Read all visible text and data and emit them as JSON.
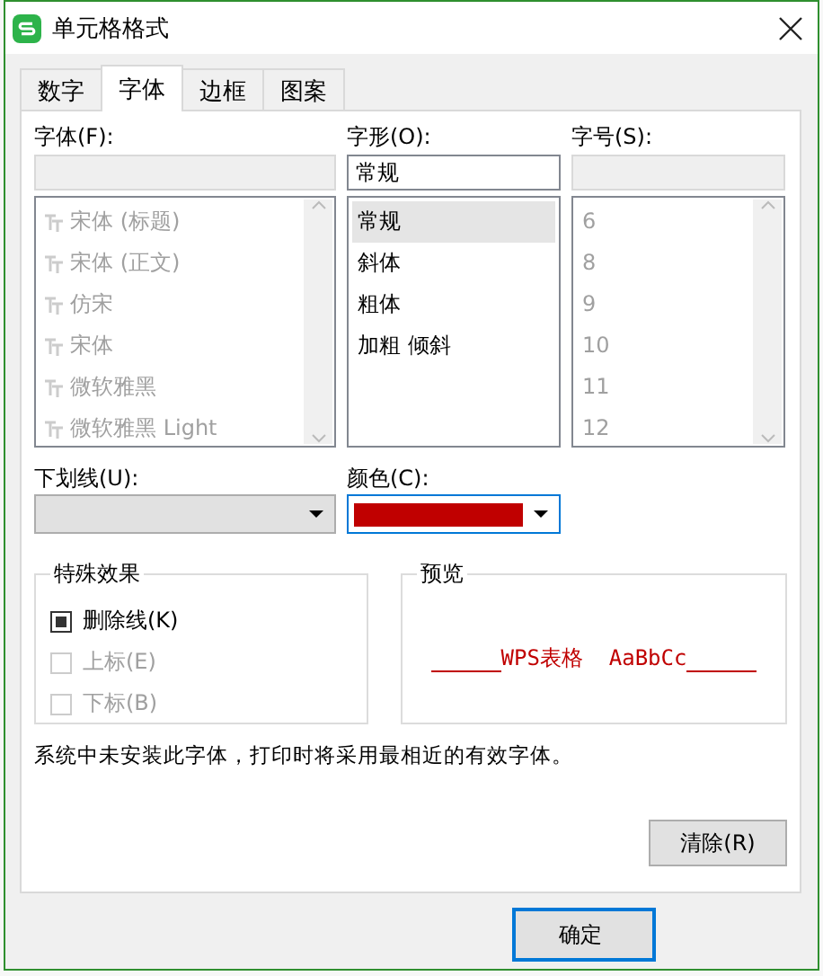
{
  "window": {
    "title": "单元格格式"
  },
  "tabs": [
    {
      "label": "数字",
      "selected": false
    },
    {
      "label": "字体",
      "selected": true
    },
    {
      "label": "边框",
      "selected": false
    },
    {
      "label": "图案",
      "selected": false
    }
  ],
  "lists": [
    {
      "label": "字体(F):",
      "disabled": true,
      "items": [
        {
          "text": "宋体 (标题)",
          "selected": false
        },
        {
          "text": "宋体 (正文)",
          "selected": false
        },
        {
          "text": "仿宋",
          "selected": false
        },
        {
          "text": "宋体",
          "selected": false
        },
        {
          "text": "微软雅黑",
          "selected": false
        },
        {
          "text": "微软雅黑 Light",
          "selected": false
        }
      ]
    },
    {
      "label": "字形(O):",
      "value": "常规",
      "disabled": false,
      "items": [
        {
          "text": "常规",
          "selected": true
        },
        {
          "text": "斜体",
          "selected": false
        },
        {
          "text": "粗体",
          "selected": false
        },
        {
          "text": "加粗 倾斜",
          "selected": false
        }
      ]
    },
    {
      "label": "字号(S):",
      "disabled": true,
      "items": [
        {
          "text": "6",
          "selected": false
        },
        {
          "text": "8",
          "selected": false
        },
        {
          "text": "9",
          "selected": false
        },
        {
          "text": "10",
          "selected": false
        },
        {
          "text": "11",
          "selected": false
        },
        {
          "text": "12",
          "selected": false
        }
      ]
    }
  ],
  "underline": {
    "label": "下划线(U):",
    "disabled": true
  },
  "color": {
    "label": "颜色(C):",
    "color": "#c00000"
  },
  "effects": {
    "title": "特殊效果",
    "options": [
      {
        "label": "删除线(K)",
        "checked": true,
        "disabled": false
      },
      {
        "label": "上标(E)",
        "checked": false,
        "disabled": true
      },
      {
        "label": "下标(B)",
        "checked": false,
        "disabled": true
      }
    ]
  },
  "preview": {
    "title": "预览",
    "text": "WPS表格  AaBbCc",
    "color": "#c00000"
  },
  "note": "系统中未安装此字体，打印时将采用最相近的有效字体。",
  "buttons": [
    {
      "label": "清除(R)",
      "kind": "clear"
    },
    {
      "label": "确定",
      "kind": "ok"
    }
  ]
}
